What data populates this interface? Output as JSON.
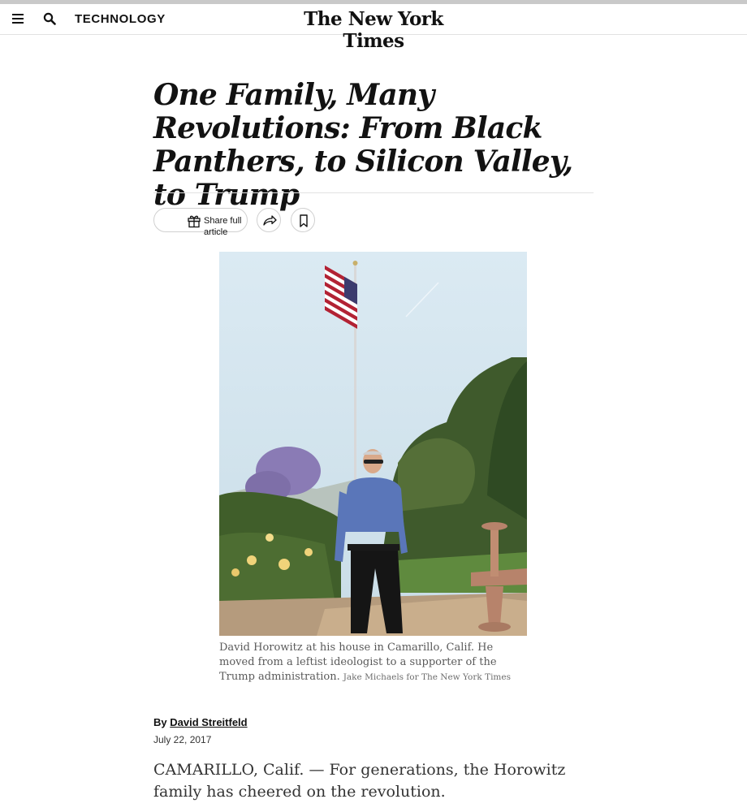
{
  "header": {
    "menu_icon": "hamburger-menu-icon",
    "search_icon": "search-icon",
    "section": "TECHNOLOGY",
    "logo": "The New York Times"
  },
  "article": {
    "headline": "One Family, Many Revolutions: From Black Panthers, to Silicon Valley, to Trump",
    "share_label": "Share full article",
    "share_icon": "gift-icon",
    "forward_icon": "share-arrow-icon",
    "save_icon": "bookmark-icon",
    "photo": {
      "caption": "David Horowitz at his house in Camarillo, Calif. He moved from a leftist ideologist to a supporter of the Trump administration.",
      "credit": "Jake Michaels for The New York Times"
    },
    "byline_prefix": "By",
    "author": "David Streitfeld",
    "date": "July 22, 2017",
    "lede": "CAMARILLO, Calif. — For generations, the Horowitz family has cheered on the revolution."
  }
}
